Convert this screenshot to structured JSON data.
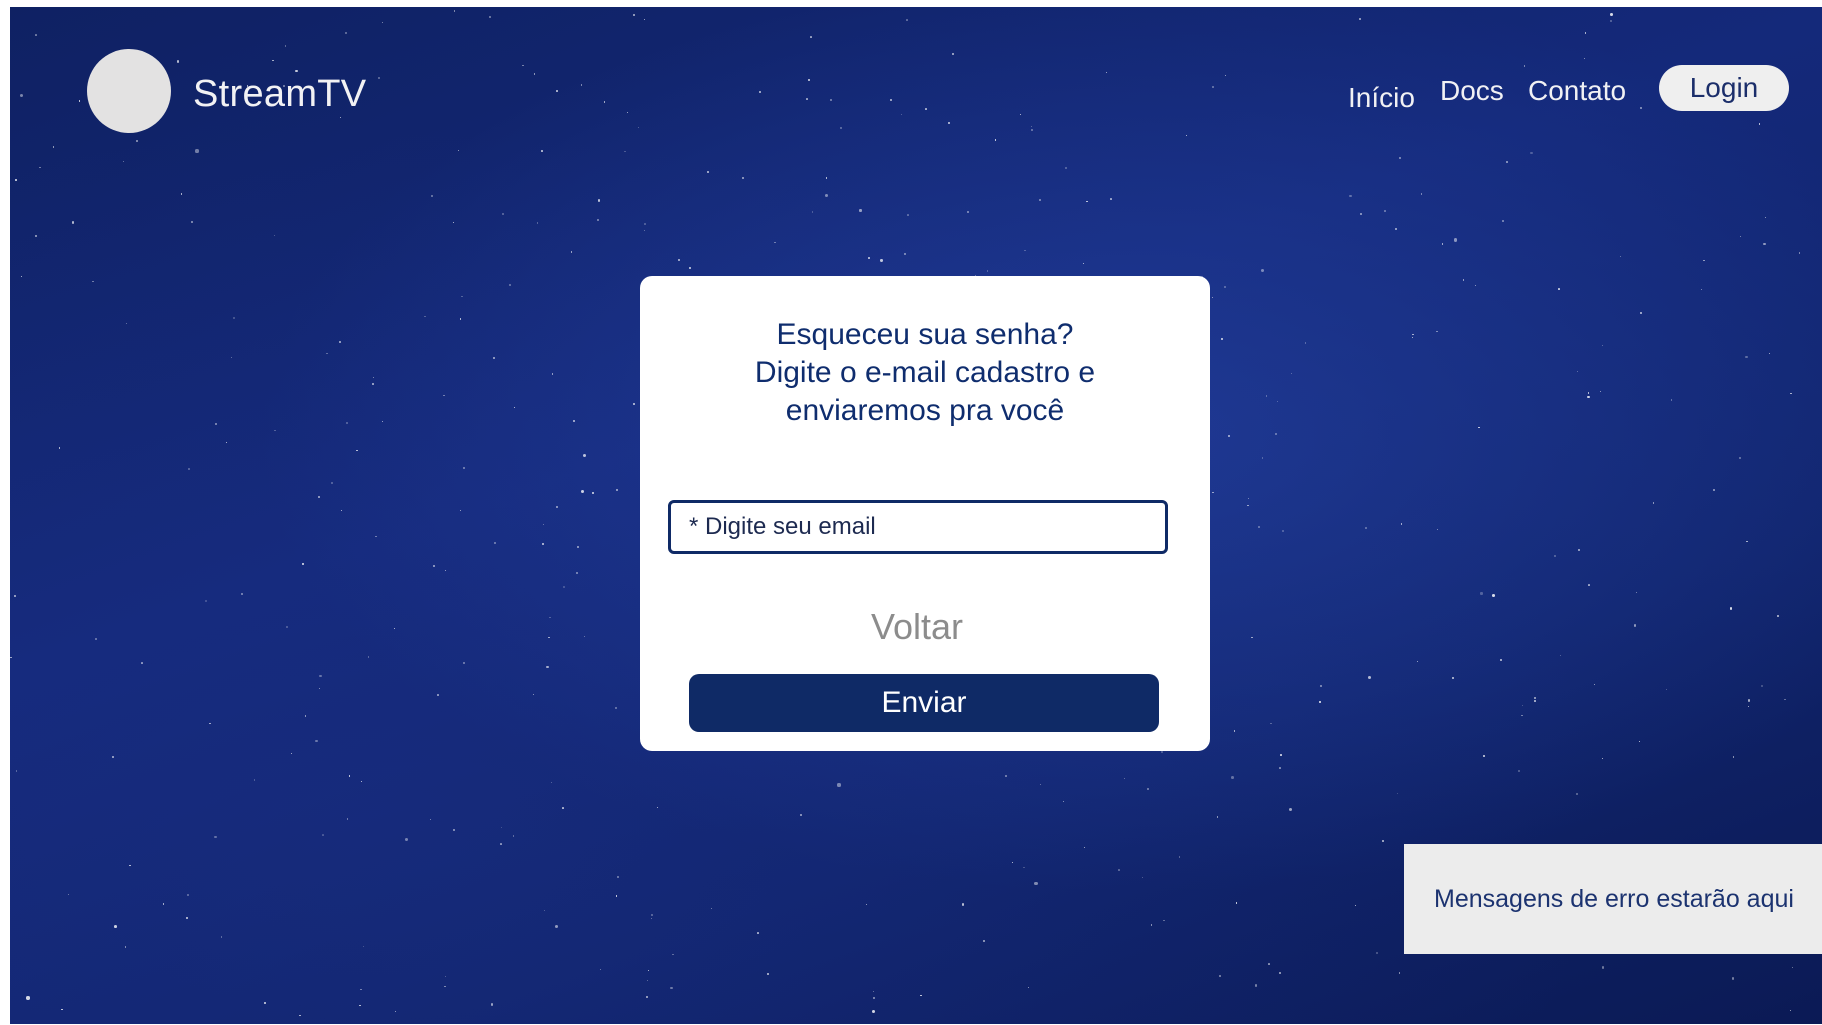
{
  "header": {
    "brand": "StreamTV",
    "nav": {
      "inicio": "Início",
      "docs": "Docs",
      "contato": "Contato",
      "login": "Login"
    }
  },
  "card": {
    "heading_lines": [
      "Esqueceu sua senha?",
      "Digite o e-mail cadastro e",
      "enviaremos pra você"
    ],
    "email_placeholder": "* Digite seu email",
    "email_value": "",
    "back_label": "Voltar",
    "submit_label": "Enviar"
  },
  "error_panel": {
    "message": "Mensagens de erro estarão aqui"
  },
  "colors": {
    "primary": "#0f2a66",
    "background": "#14297a",
    "card": "#ffffff",
    "error_panel": "#ececec"
  },
  "icons": {
    "logo": "circle-logo-placeholder"
  }
}
